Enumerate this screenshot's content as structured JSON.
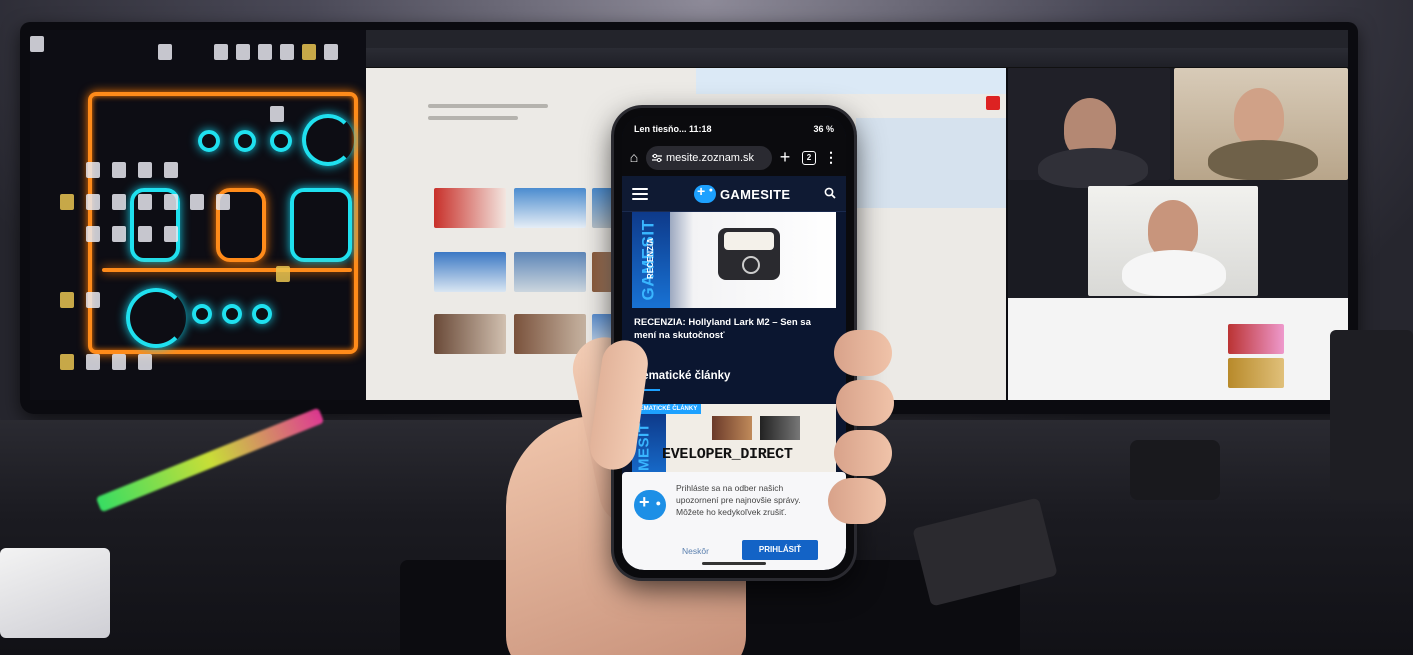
{
  "phone": {
    "status": {
      "carrier_time": "Len tiesňo... 11:18",
      "battery": "36 %"
    },
    "browser": {
      "url": "mesite.zoznam.sk",
      "tab_count": "2"
    },
    "site": {
      "logo": "GAMESITE",
      "hero": {
        "vertical_brand": "GAMESIT",
        "vertical_label": "RECENZIA"
      },
      "article_title": "RECENZIA: Hollyland Lark M2 – Sen sa mení na skutočnosť",
      "section_title": "Tematické články",
      "card": {
        "tag": "TEMATICKÉ ČLÁNKY",
        "vertical_brand": "AMESIT",
        "headline": "EVELOPER_DIRECT"
      }
    },
    "notification": {
      "text": "Prihláste sa na odber našich upozornení pre najnovšie správy. Môžete ho kedykoľvek zrušiť.",
      "later_label": "Neskôr",
      "accept_label": "PRIHLÁSIŤ"
    }
  },
  "colors": {
    "site_bg": "#0b1630",
    "accent_blue": "#1da1ff",
    "button_blue": "#1363c6",
    "neon_orange": "#ff8b1a",
    "neon_cyan": "#1fe0ef"
  },
  "icons": [
    "home-icon",
    "tune-icon",
    "plus-icon",
    "tabs-icon",
    "kebab-icon",
    "menu-icon",
    "search-icon",
    "gamesite-logo-icon"
  ]
}
